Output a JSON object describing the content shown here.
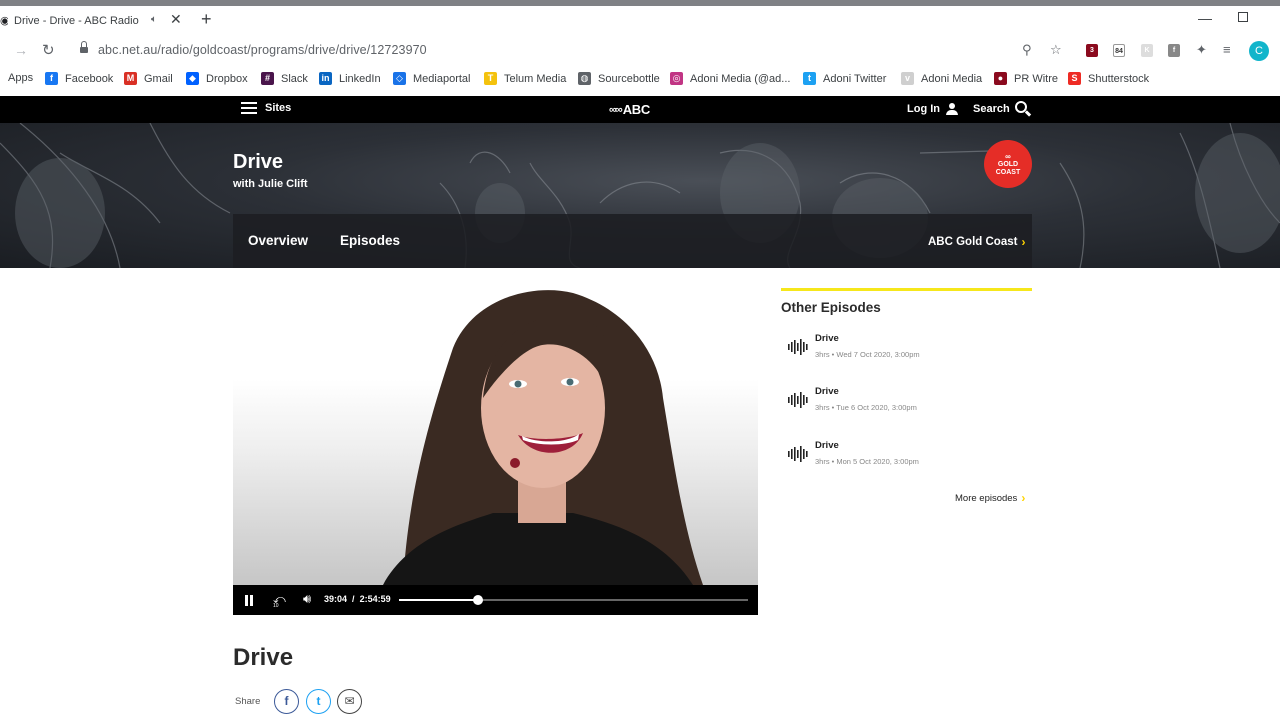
{
  "browser": {
    "tab": {
      "favicon": "abc-favicon",
      "title": "Drive - Drive - ABC Radio",
      "audio_icon": "speaker-icon",
      "close": "✕"
    },
    "new_tab": "+",
    "address": {
      "url": "abc.net.au/radio/goldcoast/programs/drive/drive/12723970"
    },
    "extensions": {
      "badge_count": "3",
      "ext2_label": "84"
    },
    "profile_initial": "C",
    "bookmarks": [
      {
        "label": "Apps",
        "icon": "apps-grid-icon"
      },
      {
        "label": "Facebook",
        "icon": "facebook-icon",
        "color": "#1877f2"
      },
      {
        "label": "Gmail",
        "icon": "gmail-icon",
        "color": "#d93025"
      },
      {
        "label": "Dropbox",
        "icon": "dropbox-icon",
        "color": "#0061ff"
      },
      {
        "label": "Slack",
        "icon": "slack-icon",
        "color": "#4a154b"
      },
      {
        "label": "LinkedIn",
        "icon": "linkedin-icon",
        "color": "#0a66c2"
      },
      {
        "label": "Mediaportal",
        "icon": "mediaportal-icon",
        "color": "#1a73e8"
      },
      {
        "label": "Telum Media",
        "icon": "telum-icon",
        "color": "#f4c20d"
      },
      {
        "label": "Sourcebottle",
        "icon": "globe-icon",
        "color": "#5f6368"
      },
      {
        "label": "Adoni Media (@ad...",
        "icon": "instagram-icon",
        "color": "#c13584"
      },
      {
        "label": "Adoni Twitter",
        "icon": "twitter-icon",
        "color": "#1da1f2"
      },
      {
        "label": "Adoni Media",
        "icon": "adoni-icon",
        "color": "#cfcfcf"
      },
      {
        "label": "PR Witre",
        "icon": "prwire-icon",
        "color": "#8b0a1e"
      },
      {
        "label": "Shutterstock",
        "icon": "shutterstock-icon",
        "color": "#ee2b24"
      }
    ]
  },
  "abc": {
    "nav": {
      "sites": "Sites",
      "logo": "ABC",
      "login": "Log In",
      "search": "Search"
    },
    "program": {
      "title": "Drive",
      "subtitle": "with Julie Clift"
    },
    "station_badge": {
      "line1": "GOLD",
      "line2": "COAST"
    },
    "subnav": {
      "tabs": [
        "Overview",
        "Episodes"
      ],
      "station_link": "ABC Gold Coast"
    },
    "player": {
      "current_time": "39:04",
      "separator": "/",
      "duration": "2:54:59",
      "rewind_label": "10",
      "progress_fraction": 0.227
    },
    "sidebar": {
      "heading": "Other Episodes",
      "episodes": [
        {
          "title": "Drive",
          "meta": "3hrs • Wed 7 Oct 2020, 3:00pm"
        },
        {
          "title": "Drive",
          "meta": "3hrs • Tue 6 Oct 2020, 3:00pm"
        },
        {
          "title": "Drive",
          "meta": "3hrs • Mon 5 Oct 2020, 3:00pm"
        }
      ],
      "more": "More episodes"
    },
    "page_title": "Drive",
    "share": {
      "label": "Share",
      "facebook": "f",
      "twitter": "t",
      "email": "✉"
    },
    "colors": {
      "accent_yellow": "#f6e71b",
      "badge_red": "#e52d27",
      "twitter": "#1da1f2",
      "facebook": "#3b5998"
    }
  }
}
